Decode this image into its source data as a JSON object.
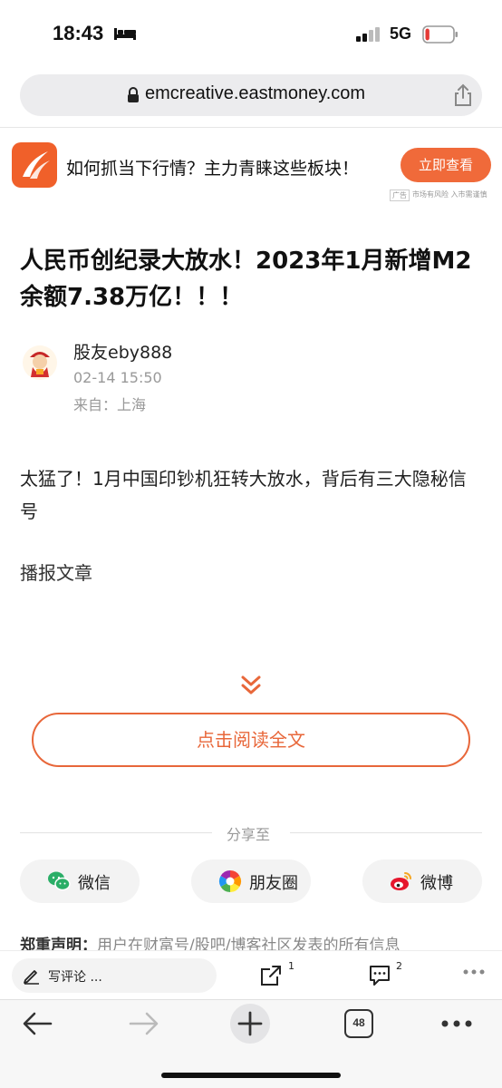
{
  "status_bar": {
    "time": "18:43",
    "network": "5G",
    "battery_level": 0.15
  },
  "browser": {
    "url": "emcreative.eastmoney.com",
    "tab_count": "48"
  },
  "ad": {
    "text": "如何抓当下行情？主力青睐这些板块！",
    "button_label": "立即查看",
    "ad_tag": "广告",
    "risk_note": "市场有风险 入市需谨慎"
  },
  "article": {
    "title": "人民币创纪录大放水！2023年1月新增M2余额7.38万亿！！！",
    "author": "股友eby888",
    "date": "02-14 15:50",
    "location": "来自：上海",
    "body": "太猛了！1月中国印钞机狂转大放水，背后有三大隐秘信号",
    "broadcast_label": "播报文章",
    "read_full_label": "点击阅读全文"
  },
  "share": {
    "label": "分享至",
    "options": [
      {
        "label": "微信",
        "icon": "wechat-icon"
      },
      {
        "label": "朋友圈",
        "icon": "moments-icon"
      },
      {
        "label": "微博",
        "icon": "weibo-icon"
      }
    ]
  },
  "disclaimer": {
    "heading": "郑重声明：",
    "text": "用户在财富号/股吧/博客社区发表的所有信息"
  },
  "comment_bar": {
    "write_label": "写评论 ...",
    "forward_count": "1",
    "comment_count": "2"
  },
  "colors": {
    "accent": "#e8673a",
    "ad_button": "#f06a3a",
    "text_muted": "#999999"
  }
}
